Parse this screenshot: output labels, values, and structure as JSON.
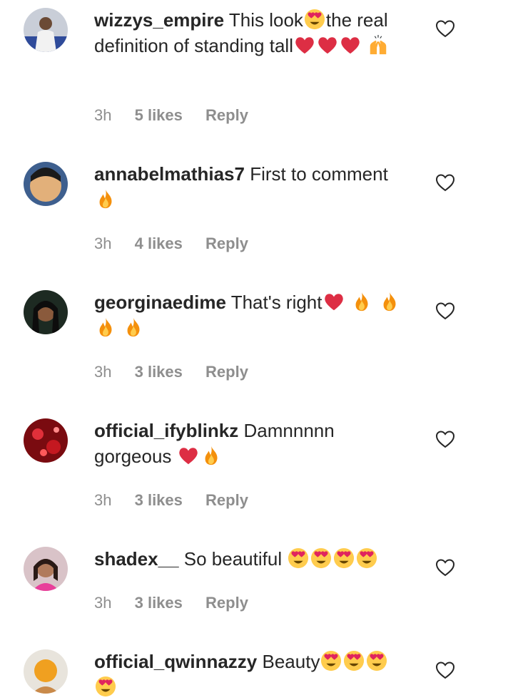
{
  "comments": [
    {
      "username": "wizzys_empire",
      "text_parts": [
        "This look",
        "the real definition of standing tall"
      ],
      "time": "3h",
      "likes": "5 likes",
      "reply": "Reply"
    },
    {
      "username": "annabelmathias7",
      "text_parts": [
        "First to comment"
      ],
      "time": "3h",
      "likes": "4 likes",
      "reply": "Reply"
    },
    {
      "username": "georginaedime",
      "text_parts": [
        "That's right"
      ],
      "time": "3h",
      "likes": "3 likes",
      "reply": "Reply"
    },
    {
      "username": "official_ifyblinkz",
      "text_parts": [
        "Damnnnnn gorgeous "
      ],
      "time": "3h",
      "likes": "3 likes",
      "reply": "Reply"
    },
    {
      "username": "shadex__",
      "text_parts": [
        "So beautiful "
      ],
      "time": "3h",
      "likes": "3 likes",
      "reply": "Reply"
    },
    {
      "username": "official_qwinnazzy",
      "text_parts": [
        "Beauty"
      ],
      "time": "",
      "likes": "",
      "reply": ""
    }
  ],
  "icons": {
    "like_button": "heart-outline-icon",
    "emoji_love": "heart-eyes-emoji-icon",
    "emoji_heart": "red-heart-emoji-icon",
    "emoji_fire": "fire-emoji-icon",
    "emoji_raised_hands": "raised-hands-emoji-icon"
  },
  "colors": {
    "text": "#262626",
    "meta": "#8e8e8e"
  }
}
